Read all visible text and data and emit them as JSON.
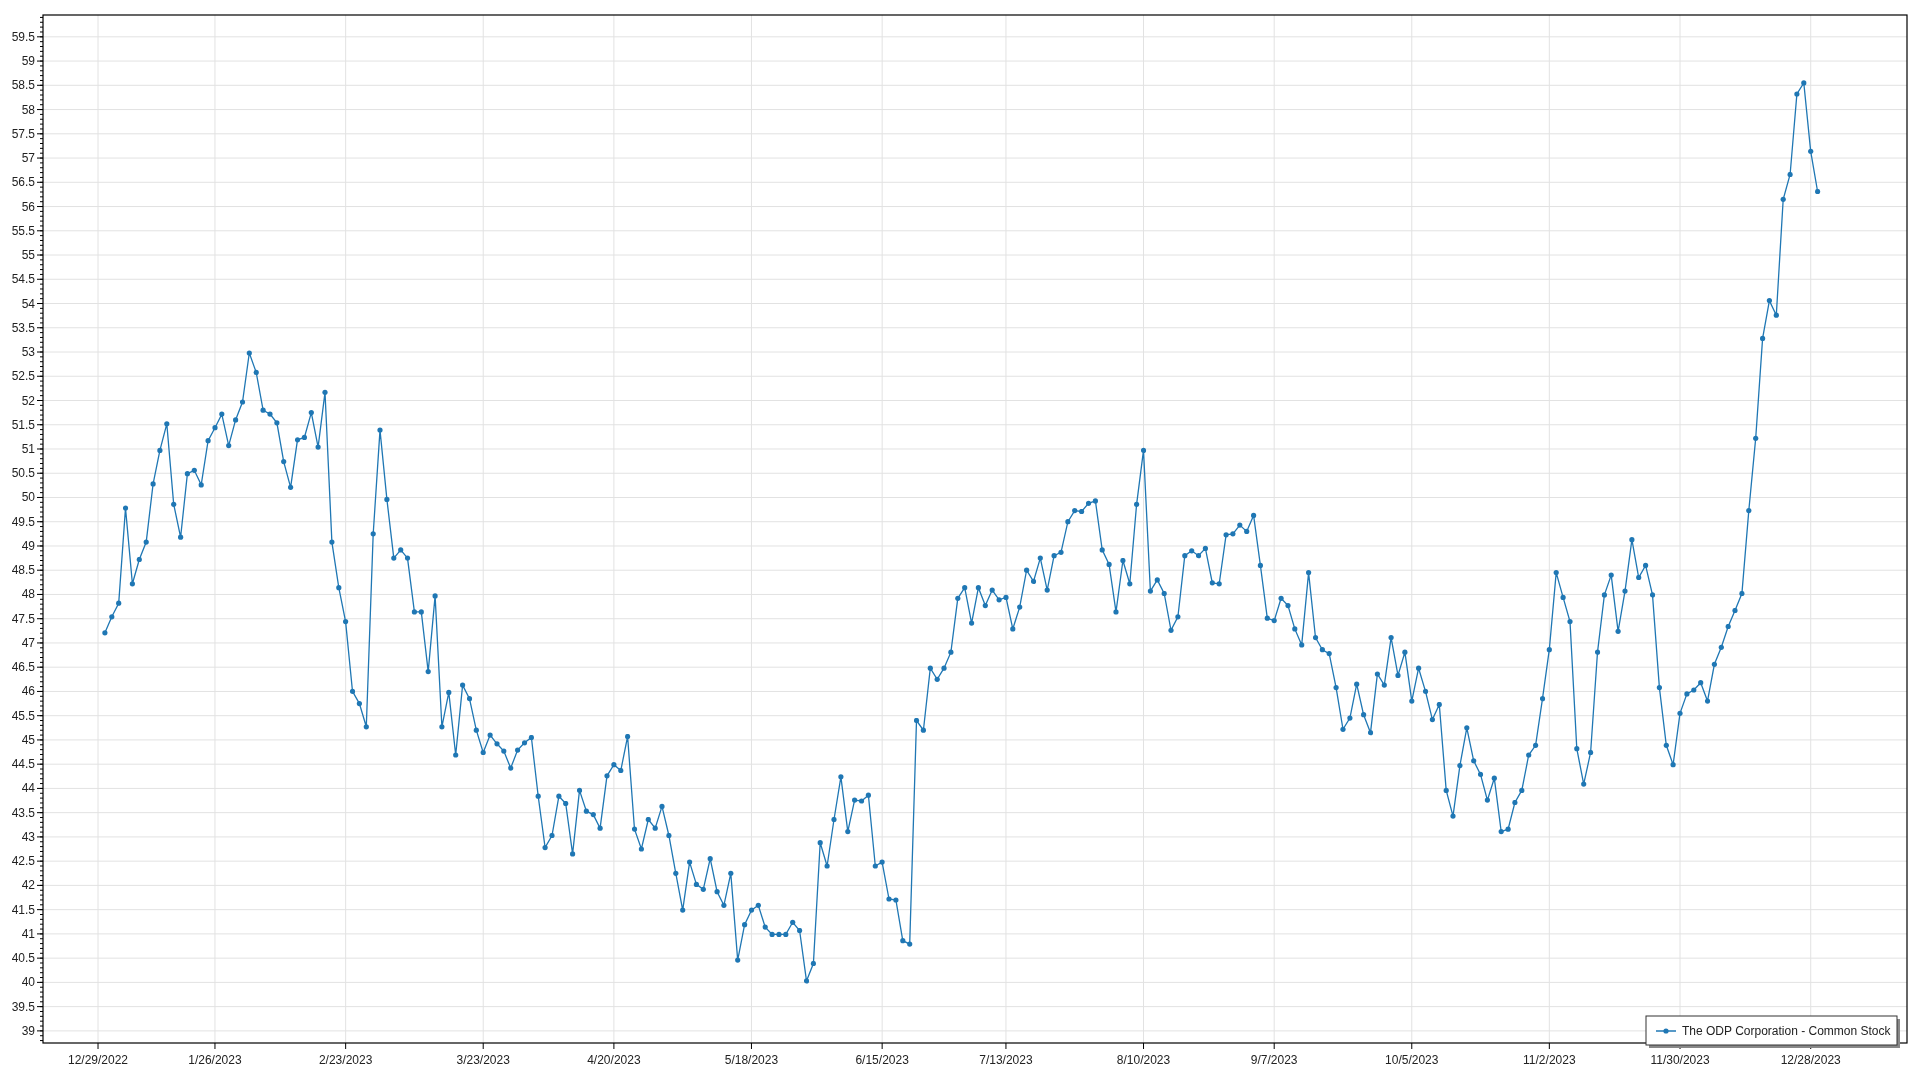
{
  "chart": {
    "chart_data": {
      "type": "line",
      "ylim": [
        38.75,
        59.95
      ],
      "categories": [
        "12/29/2022",
        null,
        null,
        null,
        null,
        null,
        null,
        null,
        null,
        null,
        null,
        null,
        null,
        null,
        null,
        null,
        null,
        "1/26/2023",
        null,
        null,
        null,
        null,
        null,
        null,
        null,
        null,
        null,
        null,
        null,
        null,
        null,
        null,
        null,
        null,
        null,
        null,
        "2/23/2023",
        null,
        null,
        null,
        null,
        null,
        null,
        null,
        null,
        null,
        null,
        null,
        null,
        null,
        null,
        null,
        null,
        null,
        null,
        null,
        "3/23/2023",
        null,
        null,
        null,
        null,
        null,
        null,
        null,
        null,
        null,
        null,
        null,
        null,
        null,
        null,
        null,
        null,
        null,
        null,
        "4/20/2023",
        null,
        null,
        null,
        null,
        null,
        null,
        null,
        null,
        null,
        null,
        null,
        null,
        null,
        null,
        null,
        null,
        null,
        null,
        null,
        "5/18/2023",
        null,
        null,
        null,
        null,
        null,
        null,
        null,
        null,
        null,
        null,
        null,
        null,
        null,
        null,
        null,
        null,
        null,
        null,
        "6/15/2023",
        null,
        null,
        null,
        null,
        null,
        null,
        null,
        null,
        null,
        null,
        null,
        null,
        null,
        null,
        null,
        null,
        null,
        "7/13/2023",
        null,
        null,
        null,
        null,
        null,
        null,
        null,
        null,
        null,
        null,
        null,
        null,
        null,
        null,
        null,
        null,
        null,
        null,
        null,
        "8/10/2023",
        null,
        null,
        null,
        null,
        null,
        null,
        null,
        null,
        null,
        null,
        null,
        null,
        null,
        null,
        null,
        null,
        null,
        null,
        "9/7/2023",
        null,
        null,
        null,
        null,
        null,
        null,
        null,
        null,
        null,
        null,
        null,
        null,
        null,
        null,
        null,
        null,
        null,
        null,
        null,
        "10/5/2023",
        null,
        null,
        null,
        null,
        null,
        null,
        null,
        null,
        null,
        null,
        null,
        null,
        null,
        null,
        null,
        null,
        null,
        null,
        null,
        "11/2/2023",
        null,
        null,
        null,
        null,
        null,
        null,
        null,
        null,
        null,
        null,
        null,
        null,
        null,
        null,
        null,
        null,
        null,
        null,
        "11/30/2023",
        null,
        null,
        null,
        null,
        null,
        null,
        null,
        null,
        null,
        null,
        null,
        null,
        null,
        null,
        null,
        null,
        null,
        null,
        "12/28/2023",
        null
      ],
      "yticks": [
        39,
        39.5,
        40,
        40.5,
        41,
        41.5,
        42,
        42.5,
        43,
        43.5,
        44,
        44.5,
        45,
        45.5,
        46,
        46.5,
        47,
        47.5,
        48,
        48.5,
        49,
        49.5,
        50,
        50.5,
        51,
        51.5,
        52,
        52.5,
        53,
        53.5,
        54,
        54.5,
        55,
        55.5,
        56,
        56.5,
        57,
        57.5,
        58,
        58.5,
        59,
        59.5
      ],
      "grid": true,
      "series": [
        {
          "name": "The ODP Corporation - Common Stock",
          "color": "#1f77b4",
          "values": [
            null,
            47.21,
            47.54,
            47.82,
            49.78,
            48.22,
            48.72,
            49.08,
            50.28,
            50.97,
            51.52,
            49.86,
            49.18,
            50.49,
            50.56,
            50.26,
            51.17,
            51.44,
            51.72,
            51.07,
            51.6,
            51.97,
            52.98,
            52.58,
            51.8,
            51.72,
            51.54,
            50.74,
            50.21,
            51.19,
            51.24,
            51.75,
            51.04,
            52.17,
            49.08,
            48.14,
            47.44,
            46.0,
            45.75,
            45.27,
            49.25,
            51.39,
            49.96,
            48.75,
            48.92,
            48.75,
            47.64,
            47.64,
            46.41,
            47.97,
            45.27,
            45.98,
            44.69,
            46.13,
            45.85,
            45.2,
            44.74,
            45.1,
            44.92,
            44.77,
            44.42,
            44.79,
            44.94,
            45.05,
            43.84,
            42.78,
            43.03,
            43.84,
            43.69,
            42.65,
            43.96,
            43.53,
            43.46,
            43.18,
            44.26,
            44.49,
            44.37,
            45.07,
            43.16,
            42.75,
            43.36,
            43.18,
            43.63,
            43.03,
            42.25,
            41.49,
            42.48,
            42.02,
            41.92,
            42.55,
            41.87,
            41.59,
            42.25,
            40.46,
            41.19,
            41.49,
            41.59,
            41.14,
            40.99,
            40.99,
            40.99,
            41.24,
            41.07,
            40.03,
            40.39,
            42.88,
            42.4,
            43.36,
            44.24,
            43.11,
            43.76,
            43.74,
            43.86,
            42.4,
            42.48,
            41.72,
            41.7,
            40.86,
            40.79,
            45.4,
            45.2,
            46.48,
            46.25,
            46.48,
            46.81,
            47.92,
            48.14,
            47.41,
            48.14,
            47.77,
            48.09,
            47.89,
            47.94,
            47.29,
            47.74,
            48.5,
            48.27,
            48.75,
            48.09,
            48.8,
            48.87,
            49.5,
            49.73,
            49.71,
            49.88,
            49.93,
            48.92,
            48.62,
            47.64,
            48.7,
            48.22,
            49.86,
            50.97,
            48.07,
            48.3,
            48.02,
            47.26,
            47.54,
            48.8,
            48.9,
            48.8,
            48.95,
            48.24,
            48.22,
            49.23,
            49.25,
            49.43,
            49.3,
            49.63,
            48.6,
            47.51,
            47.46,
            47.92,
            47.77,
            47.29,
            46.96,
            48.45,
            47.11,
            46.86,
            46.78,
            46.08,
            45.22,
            45.45,
            46.15,
            45.52,
            45.15,
            46.36,
            46.13,
            47.11,
            46.33,
            46.81,
            45.8,
            46.48,
            46.0,
            45.42,
            45.73,
            43.96,
            43.43,
            44.47,
            45.25,
            44.57,
            44.29,
            43.76,
            44.21,
            43.11,
            43.16,
            43.71,
            43.96,
            44.69,
            44.89,
            45.85,
            46.86,
            48.45,
            47.94,
            47.44,
            44.82,
            44.09,
            44.74,
            46.81,
            47.99,
            48.4,
            47.24,
            48.07,
            49.13,
            48.35,
            48.6,
            47.99,
            46.08,
            44.89,
            44.49,
            45.55,
            45.95,
            46.03,
            46.18,
            45.8,
            46.56,
            46.91,
            47.34,
            47.67,
            48.02,
            49.73,
            51.22,
            53.28,
            54.06,
            53.76,
            56.15,
            56.66,
            58.32,
            58.55,
            57.14,
            56.31
          ]
        }
      ]
    }
  }
}
